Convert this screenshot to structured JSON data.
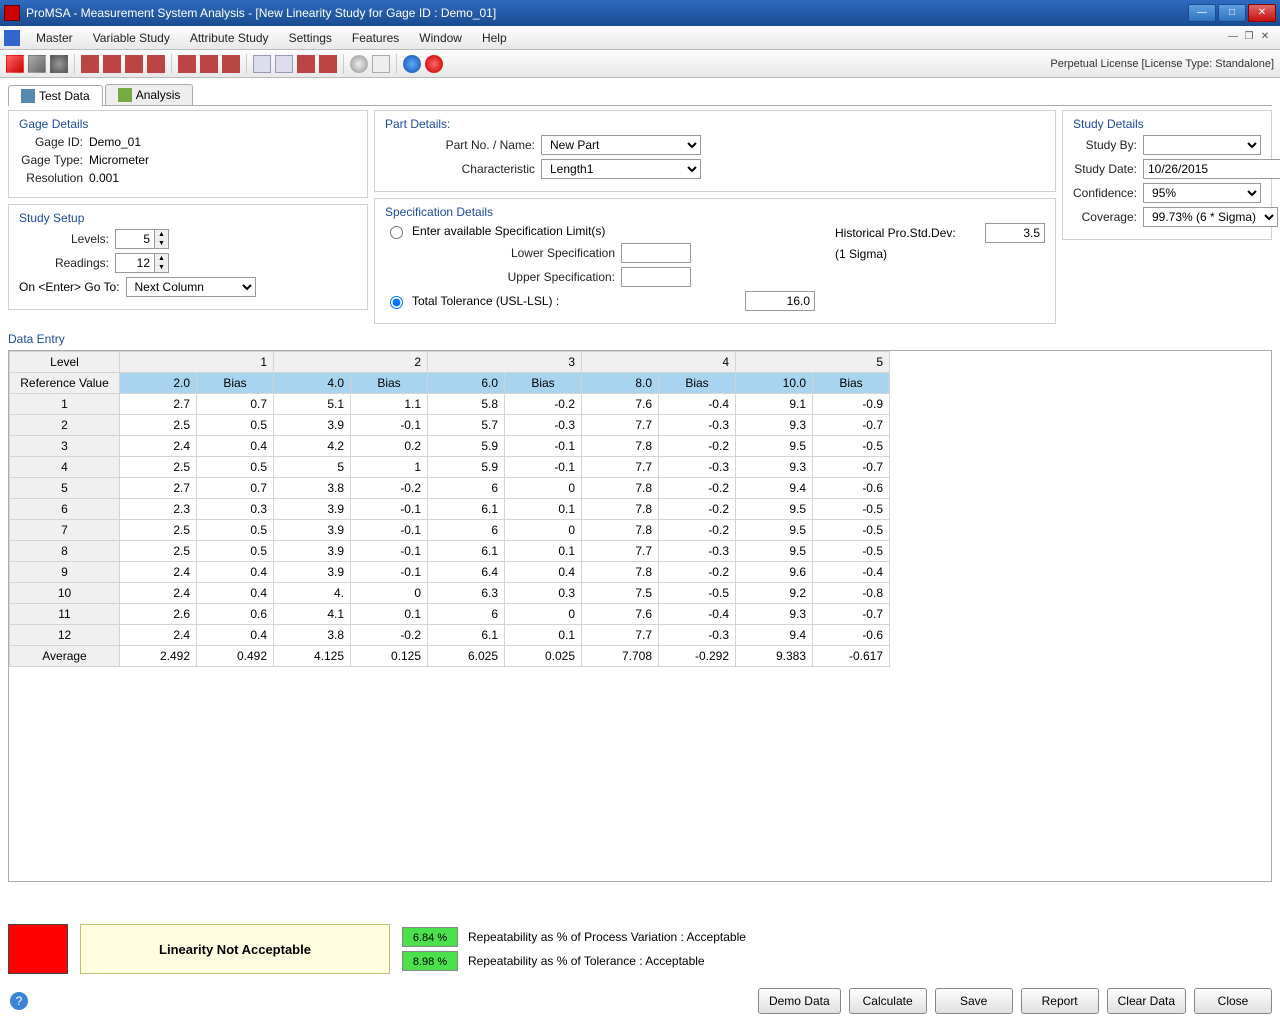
{
  "window": {
    "title": "ProMSA - Measurement System Analysis  -  [New Linearity Study for Gage ID :  Demo_01]"
  },
  "menu": {
    "items": [
      "Master",
      "Variable Study",
      "Attribute Study",
      "Settings",
      "Features",
      "Window",
      "Help"
    ]
  },
  "license": "Perpetual License [License Type: Standalone]",
  "tabs": {
    "t1": "Test Data",
    "t2": "Analysis"
  },
  "gage": {
    "section": "Gage Details",
    "id_lbl": "Gage ID:",
    "id_val": "Demo_01",
    "type_lbl": "Gage Type:",
    "type_val": "Micrometer",
    "res_lbl": "Resolution",
    "res_val": "0.001"
  },
  "setup": {
    "section": "Study Setup",
    "levels_lbl": "Levels:",
    "levels_val": "5",
    "readings_lbl": "Readings:",
    "readings_val": "12",
    "enter_lbl": "On <Enter> Go To:",
    "enter_val": "Next Column"
  },
  "part": {
    "section": "Part Details:",
    "partno_lbl": "Part No. / Name:",
    "partno_val": "New Part",
    "char_lbl": "Characteristic",
    "char_val": "Length1"
  },
  "spec": {
    "section": "Specification Details",
    "opt1": "Enter available Specification Limit(s)",
    "lower_lbl": "Lower Specification",
    "lower_val": "",
    "upper_lbl": "Upper Specification:",
    "upper_val": "",
    "opt2": "Total Tolerance (USL-LSL) :",
    "tol_val": "16.0",
    "hist_lbl": "Historical Pro.Std.Dev:",
    "hist_sub": "(1 Sigma)",
    "hist_val": "3.5"
  },
  "study": {
    "section": "Study Details",
    "by_lbl": "Study By:",
    "by_val": "",
    "date_lbl": "Study Date:",
    "date_val": "10/26/2015",
    "conf_lbl": "Confidence:",
    "conf_val": "95%",
    "cov_lbl": "Coverage:",
    "cov_val": "99.73% (6 * Sigma)"
  },
  "data_entry": {
    "section": "Data Entry",
    "level_lbl": "Level",
    "ref_lbl": "Reference Value",
    "bias_lbl": "Bias",
    "avg_lbl": "Average",
    "levels": [
      "1",
      "2",
      "3",
      "4",
      "5"
    ],
    "ref": [
      "2.0",
      "4.0",
      "6.0",
      "8.0",
      "10.0"
    ],
    "rows": [
      {
        "n": "1",
        "v": [
          "2.7",
          "0.7",
          "5.1",
          "1.1",
          "5.8",
          "-0.2",
          "7.6",
          "-0.4",
          "9.1",
          "-0.9"
        ]
      },
      {
        "n": "2",
        "v": [
          "2.5",
          "0.5",
          "3.9",
          "-0.1",
          "5.7",
          "-0.3",
          "7.7",
          "-0.3",
          "9.3",
          "-0.7"
        ]
      },
      {
        "n": "3",
        "v": [
          "2.4",
          "0.4",
          "4.2",
          "0.2",
          "5.9",
          "-0.1",
          "7.8",
          "-0.2",
          "9.5",
          "-0.5"
        ]
      },
      {
        "n": "4",
        "v": [
          "2.5",
          "0.5",
          "5",
          "1",
          "5.9",
          "-0.1",
          "7.7",
          "-0.3",
          "9.3",
          "-0.7"
        ]
      },
      {
        "n": "5",
        "v": [
          "2.7",
          "0.7",
          "3.8",
          "-0.2",
          "6",
          "0",
          "7.8",
          "-0.2",
          "9.4",
          "-0.6"
        ]
      },
      {
        "n": "6",
        "v": [
          "2.3",
          "0.3",
          "3.9",
          "-0.1",
          "6.1",
          "0.1",
          "7.8",
          "-0.2",
          "9.5",
          "-0.5"
        ]
      },
      {
        "n": "7",
        "v": [
          "2.5",
          "0.5",
          "3.9",
          "-0.1",
          "6",
          "0",
          "7.8",
          "-0.2",
          "9.5",
          "-0.5"
        ]
      },
      {
        "n": "8",
        "v": [
          "2.5",
          "0.5",
          "3.9",
          "-0.1",
          "6.1",
          "0.1",
          "7.7",
          "-0.3",
          "9.5",
          "-0.5"
        ]
      },
      {
        "n": "9",
        "v": [
          "2.4",
          "0.4",
          "3.9",
          "-0.1",
          "6.4",
          "0.4",
          "7.8",
          "-0.2",
          "9.6",
          "-0.4"
        ]
      },
      {
        "n": "10",
        "v": [
          "2.4",
          "0.4",
          "4.",
          "0",
          "6.3",
          "0.3",
          "7.5",
          "-0.5",
          "9.2",
          "-0.8"
        ]
      },
      {
        "n": "11",
        "v": [
          "2.6",
          "0.6",
          "4.1",
          "0.1",
          "6",
          "0",
          "7.6",
          "-0.4",
          "9.3",
          "-0.7"
        ]
      },
      {
        "n": "12",
        "v": [
          "2.4",
          "0.4",
          "3.8",
          "-0.2",
          "6.1",
          "0.1",
          "7.7",
          "-0.3",
          "9.4",
          "-0.6"
        ]
      }
    ],
    "avg": [
      "2.492",
      "0.492",
      "4.125",
      "0.125",
      "6.025",
      "0.025",
      "7.708",
      "-0.292",
      "9.383",
      "-0.617"
    ]
  },
  "status": {
    "linearity": "Linearity Not Acceptable",
    "p1": "6.84 %",
    "t1": "Repeatability as % of Process Variation : Acceptable",
    "p2": "8.98 %",
    "t2": "Repeatability as % of Tolerance : Acceptable"
  },
  "buttons": {
    "demo": "Demo Data",
    "calc": "Calculate",
    "save": "Save",
    "report": "Report",
    "clear": "Clear Data",
    "close": "Close"
  }
}
